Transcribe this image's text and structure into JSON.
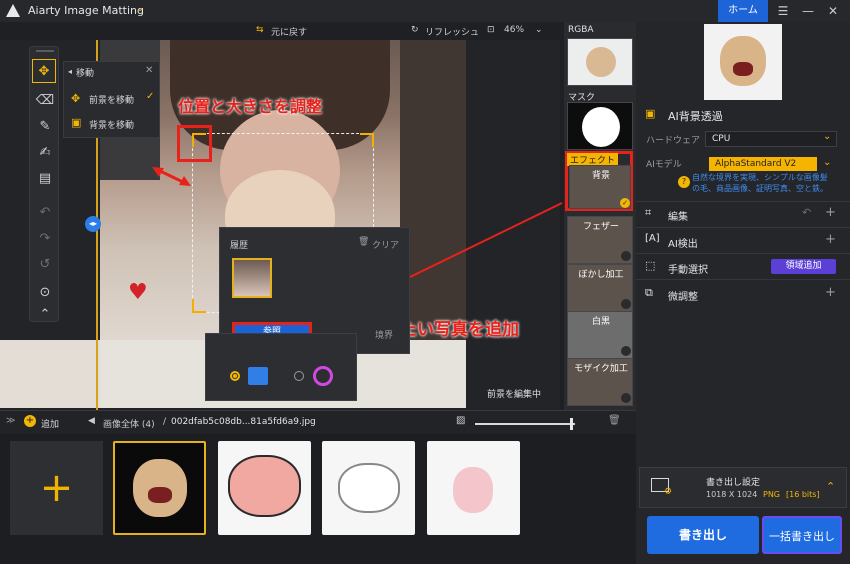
{
  "app": {
    "title": "Aiarty Image Matting",
    "home_label": "ホーム"
  },
  "canvas_toolbar": {
    "undo_label": "元に戻す",
    "refresh_label": "リフレッシュ",
    "zoom": "46%"
  },
  "move_popup": {
    "title": "移動",
    "fg_move": "前景を移動",
    "bg_move": "背景を移動"
  },
  "annotations": {
    "position_size": "位置と大きさを調整",
    "add_photo": "顔隠したい写真を追加"
  },
  "history_popup": {
    "title": "履歴",
    "clear": "クリア",
    "browse": "参照",
    "edge_partial": "境界"
  },
  "status": {
    "editing_fg": "前景を編集中"
  },
  "thumbnails": {
    "rgba": "RGBA",
    "mask": "マスク",
    "effect_tag": "エフェクト",
    "items": [
      "背景",
      "フェザー",
      "ぼかし加工",
      "白黒",
      "モザイク加工"
    ]
  },
  "right_panel": {
    "ai_bg": "AI背景透過",
    "hardware_label": "ハードウェア",
    "hardware_value": "CPU",
    "ai_model_label": "AIモデル",
    "ai_model_value": "AlphaStandard  V2",
    "ai_model_desc": "自然な境界を実現、シンプルな画像髪の毛、商品画像、証明写真、空と鉄。",
    "edit": "編集",
    "ai_detect": "AI検出",
    "manual_select": "手動選択",
    "add_region": "領域追加",
    "fine_tune": "微調整",
    "export_settings": "書き出し設定",
    "export_size": "1018 X 1024",
    "export_format": "PNG",
    "export_bits": "[16 bits]",
    "export_button": "書き出し",
    "batch_button": "一括書き出し"
  },
  "bottom_bar": {
    "add_label": "追加",
    "breadcrumb_all": "画像全体 (4)",
    "separator": "/",
    "filename": "002dfab5c08db...81a5fd6a9.jpg"
  },
  "colors": {
    "accent_blue": "#1d64d8",
    "accent_yellow": "#f2b705",
    "annotation_red": "#e8221b"
  },
  "icons": [
    "move-icon",
    "eraser-icon",
    "brush-icon",
    "paint-icon",
    "roller-icon",
    "undo-icon",
    "redo-icon",
    "reset-icon",
    "fit-icon",
    "collapse-icon",
    "image-icon",
    "trash-icon",
    "gear-icon"
  ]
}
